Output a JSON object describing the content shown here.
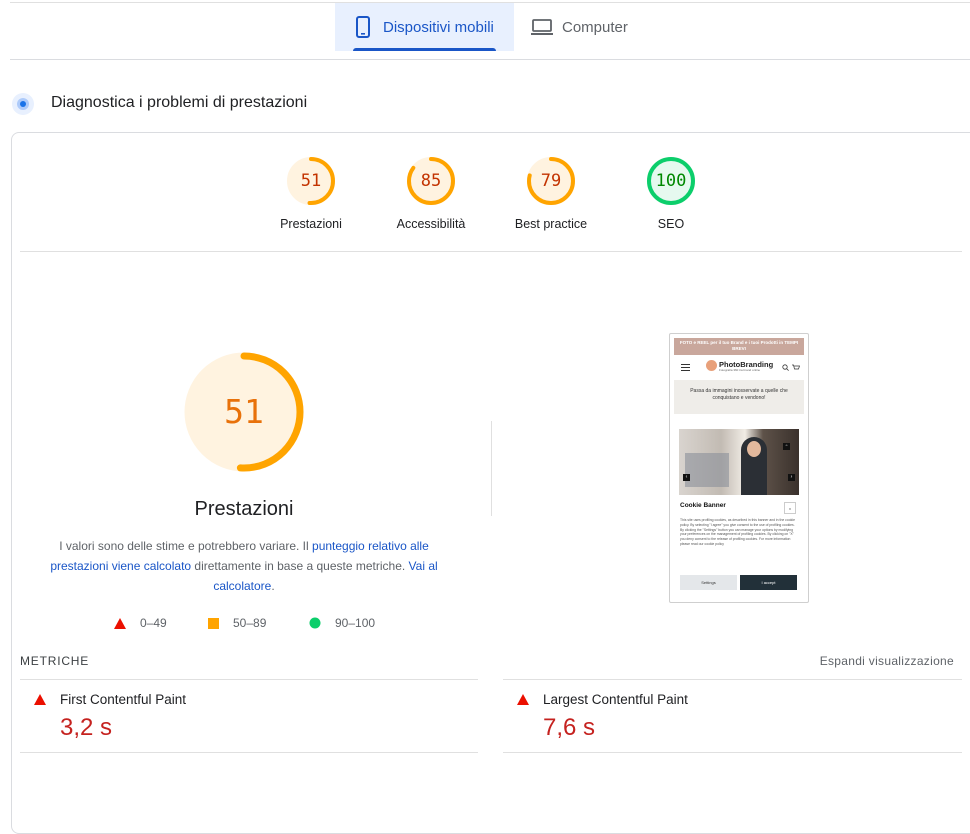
{
  "tabs": {
    "mobile": {
      "label": "Dispositivi mobili",
      "icon": "smartphone-icon",
      "active": true
    },
    "desktop": {
      "label": "Computer",
      "icon": "laptop-icon",
      "active": false
    }
  },
  "diagnostics": {
    "title": "Diagnostica i problemi di prestazioni",
    "icon": "diagnostics-icon"
  },
  "scores": [
    {
      "value": 51,
      "label": "Prestazioni",
      "color": "#e8710a"
    },
    {
      "value": 85,
      "label": "Accessibilità",
      "color": "#e8710a"
    },
    {
      "value": 79,
      "label": "Best practice",
      "color": "#e8710a"
    },
    {
      "value": 100,
      "label": "SEO",
      "color": "#008800"
    }
  ],
  "performance": {
    "score": 51,
    "title": "Prestazioni",
    "desc_1": "I valori sono delle stime e potrebbero variare. Il ",
    "desc_link_1": "punteggio relativo alle prestazioni viene calcolato",
    "desc_2": " direttamente in base a queste metriche. ",
    "desc_link_2": "Vai al calcolatore",
    "desc_3": "."
  },
  "legend": [
    {
      "range": "0–49",
      "shape": "triangle",
      "color": "#eb0f00"
    },
    {
      "range": "50–89",
      "shape": "square",
      "color": "#ffa400"
    },
    {
      "range": "90–100",
      "shape": "circle",
      "color": "#0cce6b"
    }
  ],
  "metrics": {
    "heading": "METRICHE",
    "expand_label": "Espandi visualizzazione",
    "items": [
      {
        "name": "First Contentful Paint",
        "value": "3,2 s",
        "status_color": "#c5221f"
      },
      {
        "name": "Largest Contentful Paint",
        "value": "7,6 s",
        "status_color": "#c5221f"
      }
    ]
  },
  "preview": {
    "banner": "FOTO e REEL per il tuo Brand e i tuoi Prodotti in TEMPI BREVI",
    "logo": "PhotoBranding",
    "logo_sub": "Fotografia 360 tra brand online",
    "hero_text": "Passa da immagini inosservate a quelle che conquistano e vendono!",
    "cookie_title": "Cookie Banner",
    "cookie_close": "x",
    "cookie_text": "This site uses profiling cookies, as described in this banner and in the cookie policy. By selecting \"I agree\" you give consent to the use of profiling cookies. By clicking the \"Settings\" button you can manage your options by modifying your preferences on the management of profiling cookies. By clicking on \"X\" you deny consent to the release of profiling cookies. For more information please read our cookie policy",
    "settings_label": "Settings",
    "accept_label": "I accept"
  }
}
